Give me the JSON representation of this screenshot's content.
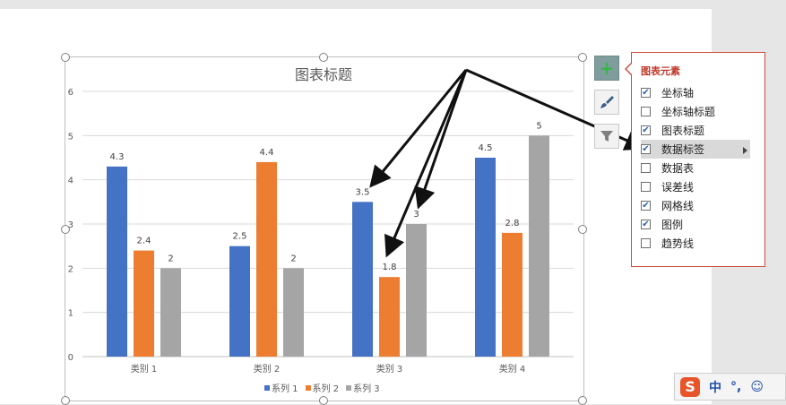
{
  "chart": {
    "title": "图表标题"
  },
  "chart_data": {
    "type": "bar",
    "title": "图表标题",
    "categories": [
      "类别 1",
      "类别 2",
      "类别 3",
      "类别 4"
    ],
    "series": [
      {
        "name": "系列 1",
        "color": "#4472c4",
        "values": [
          4.3,
          2.5,
          3.5,
          4.5
        ]
      },
      {
        "name": "系列 2",
        "color": "#ed7d31",
        "values": [
          2.4,
          4.4,
          1.8,
          2.8
        ]
      },
      {
        "name": "系列 3",
        "color": "#a5a5a5",
        "values": [
          2,
          2,
          3,
          5
        ]
      }
    ],
    "ylim": [
      0,
      6
    ],
    "yticks": [
      0,
      1,
      2,
      3,
      4,
      5,
      6
    ],
    "grid": true,
    "legend": "bottom",
    "data_labels": true
  },
  "side_buttons": {
    "plus": "plus-icon",
    "brush": "brush-icon",
    "filter": "filter-icon"
  },
  "popup": {
    "title": "图表元素",
    "options": [
      {
        "label": "坐标轴",
        "checked": true
      },
      {
        "label": "坐标轴标题",
        "checked": false
      },
      {
        "label": "图表标题",
        "checked": true
      },
      {
        "label": "数据标签",
        "checked": true,
        "hover": true
      },
      {
        "label": "数据表",
        "checked": false
      },
      {
        "label": "误差线",
        "checked": false
      },
      {
        "label": "网格线",
        "checked": true
      },
      {
        "label": "图例",
        "checked": true
      },
      {
        "label": "趋势线",
        "checked": false
      }
    ]
  },
  "ime": {
    "logo": "S",
    "lang": "中",
    "punct": "°,",
    "emoji": "☺"
  }
}
